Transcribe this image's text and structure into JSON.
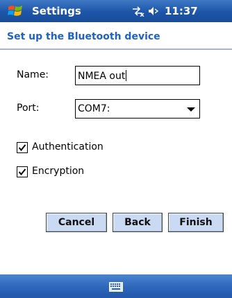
{
  "titlebar": {
    "title": "Settings",
    "time": "11:37"
  },
  "header": {
    "text": "Set up the Bluetooth device"
  },
  "form": {
    "name_label": "Name:",
    "name_value": "NMEA out",
    "port_label": "Port:",
    "port_value": "COM7:",
    "authentication_label": "Authentication",
    "authentication_checked": true,
    "encryption_label": "Encryption",
    "encryption_checked": true
  },
  "buttons": {
    "cancel": "Cancel",
    "back": "Back",
    "finish": "Finish"
  },
  "icons": {
    "start": "windows-flag-icon",
    "connectivity": "connectivity-icon",
    "volume": "speaker-icon",
    "input": "keyboard-icon"
  },
  "colors": {
    "titlebar": "#1d55a8",
    "header_text": "#1e62c8",
    "button": "#cbdaf3"
  }
}
